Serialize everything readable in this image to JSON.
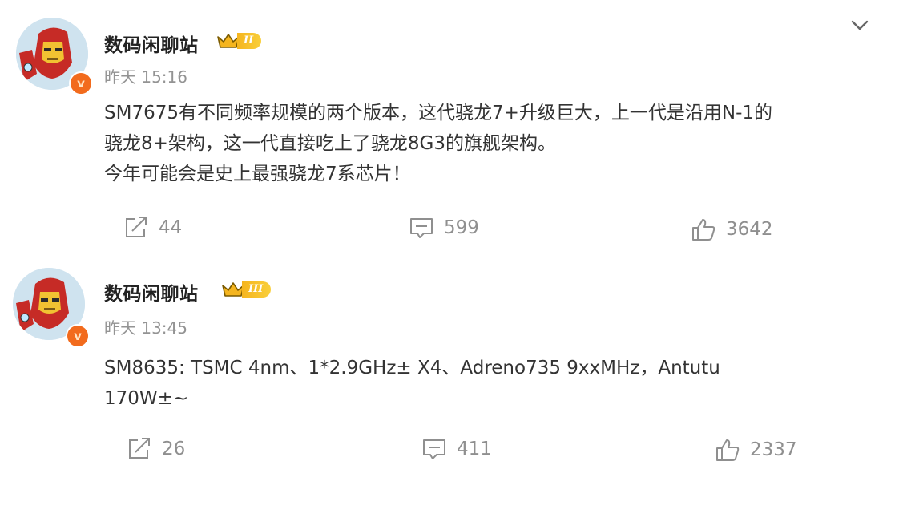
{
  "posts": [
    {
      "username": "数码闲聊站",
      "level_badge": "II",
      "verified_mark": "v",
      "timestamp": "昨天 15:16",
      "content_lines": [
        "SM7675有不同频率规模的两个版本，这代骁龙7+升级巨大，上一代是沿用N-1的",
        "骁龙8+架构，这一代直接吃上了骁龙8G3的旗舰架构。",
        "今年可能会是史上最强骁龙7系芯片！"
      ],
      "actions": {
        "repost": "44",
        "comment": "599",
        "like": "3642"
      }
    },
    {
      "username": "数码闲聊站",
      "level_badge": "III",
      "verified_mark": "v",
      "timestamp": "昨天 13:45",
      "content_lines": [
        "SM8635: TSMC 4nm、1*2.9GHz± X4、Adreno735 9xxMHz，Antutu",
        "170W±~"
      ],
      "actions": {
        "repost": "26",
        "comment": "411",
        "like": "2337"
      }
    }
  ],
  "icons": {
    "more": "chevron-down-icon",
    "repost": "share-icon",
    "comment": "comment-icon",
    "like": "thumbs-up-icon",
    "level": "crown-icon"
  },
  "colors": {
    "text": "#333333",
    "meta": "#939393",
    "badge_gold": "#f5b51f",
    "verified_orange": "#f26b1d"
  }
}
